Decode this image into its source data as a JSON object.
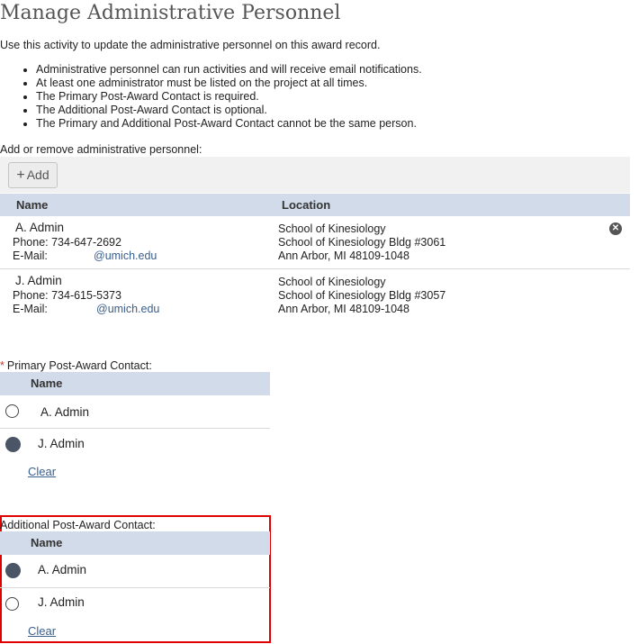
{
  "page": {
    "title": "Manage Administrative Personnel",
    "intro": "Use this activity to update the administrative personnel on this award record.",
    "bullets": [
      "Administrative personnel can run activities and will receive email notifications.",
      "At least one administrator must be listed on the project at all times.",
      "The Primary Post-Award Contact is required.",
      "The Additional Post-Award Contact is optional.",
      "The Primary and Additional Post-Award Contact cannot be the same person."
    ]
  },
  "personnel": {
    "label": "Add or remove administrative personnel:",
    "add_button": "Add",
    "columns": [
      "Name",
      "Location"
    ],
    "rows": [
      {
        "name": "A. Admin",
        "phone": "Phone: 734-647-2692",
        "email_label": "E-Mail:",
        "email": "@umich.edu",
        "location": [
          "School of Kinesiology",
          "School of Kinesiology Bldg #3061",
          "Ann Arbor, MI 48109-1048"
        ],
        "removable": true
      },
      {
        "name": "J. Admin",
        "phone": "Phone: 734-615-5373",
        "email_label": "E-Mail:",
        "email": "@umich.edu",
        "location": [
          "School of Kinesiology",
          "School of Kinesiology Bldg #3057",
          "Ann Arbor, MI 48109-1048"
        ],
        "removable": false
      }
    ]
  },
  "primary_contact": {
    "required_mark": "*",
    "label": "Primary Post-Award Contact:",
    "column": "Name",
    "options": [
      {
        "name": "A. Admin",
        "selected": false
      },
      {
        "name": "J. Admin",
        "selected": true
      }
    ],
    "clear": "Clear"
  },
  "additional_contact": {
    "label": "Additional Post-Award Contact:",
    "column": "Name",
    "options": [
      {
        "name": "A. Admin",
        "selected": true
      },
      {
        "name": "J. Admin",
        "selected": false
      }
    ],
    "clear": "Clear"
  },
  "colors": {
    "header_bg": "#d2dbea",
    "link": "#3a5e8c",
    "highlight": "#e00000",
    "required": "#c0392b"
  },
  "icons": {
    "add": "plus-icon",
    "remove": "close-circle-icon"
  }
}
